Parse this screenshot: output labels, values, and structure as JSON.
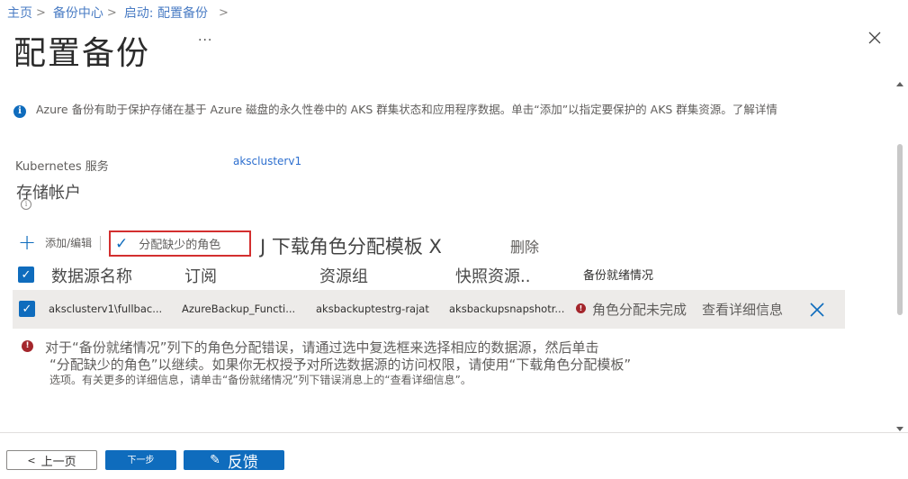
{
  "breadcrumb": {
    "items": [
      "主页",
      "备份中心",
      "启动: 配置备份"
    ],
    "separator": ">",
    "trailing": ">"
  },
  "page": {
    "title": "配置备份",
    "more": "...",
    "close_icon": "close-icon"
  },
  "info": {
    "icon": "info-icon",
    "text": "Azure 备份有助于保护存储在基于 Azure 磁盘的永久性卷中的 AKS 群集状态和应用程序数据。单击“添加”以指定要保护的 AKS 群集资源。",
    "learn_more": "了解详情"
  },
  "kubernetes": {
    "label": "Kubernetes 服务",
    "value": "aksclusterv1"
  },
  "storage": {
    "label": "存储帐户",
    "info_icon": "info-circle-icon"
  },
  "toolbar": {
    "add_edit": "添加/编辑",
    "assign_roles": "分配缺少的角色",
    "download_template": "J 下载角色分配模板 X",
    "delete": "删除"
  },
  "table": {
    "columns": [
      "数据源名称",
      "订阅",
      "资源组",
      "快照资源..",
      "备份就绪情况"
    ],
    "rows": [
      {
        "checked": true,
        "source": "aksclusterv1\\fullbac...",
        "subscription": "AzureBackup_Functi...",
        "resource_group": "aksbackuptestrg-rajat",
        "snapshot": "aksbackupsnapshotr...",
        "status": "角色分配未完成",
        "details_link": "查看详细信息"
      }
    ]
  },
  "note": {
    "icon": "error-icon",
    "line1": "对于“备份就绪情况”列下的角色分配错误，请通过选中复选框来选择相应的数据源，然后单击",
    "line2": "“分配缺少的角色”以继续。如果你无权授予对所选数据源的访问权限，请使用“下载角色分配模板”",
    "line3": "选项。有关更多的详细信息，请单击“备份就绪情况”列下错误消息上的“查看详细信息”。"
  },
  "footer": {
    "prev": "上一页",
    "next": "下一步",
    "feedback": "反馈"
  },
  "colors": {
    "accent": "#0f6cbd",
    "error": "#a4262c",
    "highlight_border": "#d32f2f"
  }
}
